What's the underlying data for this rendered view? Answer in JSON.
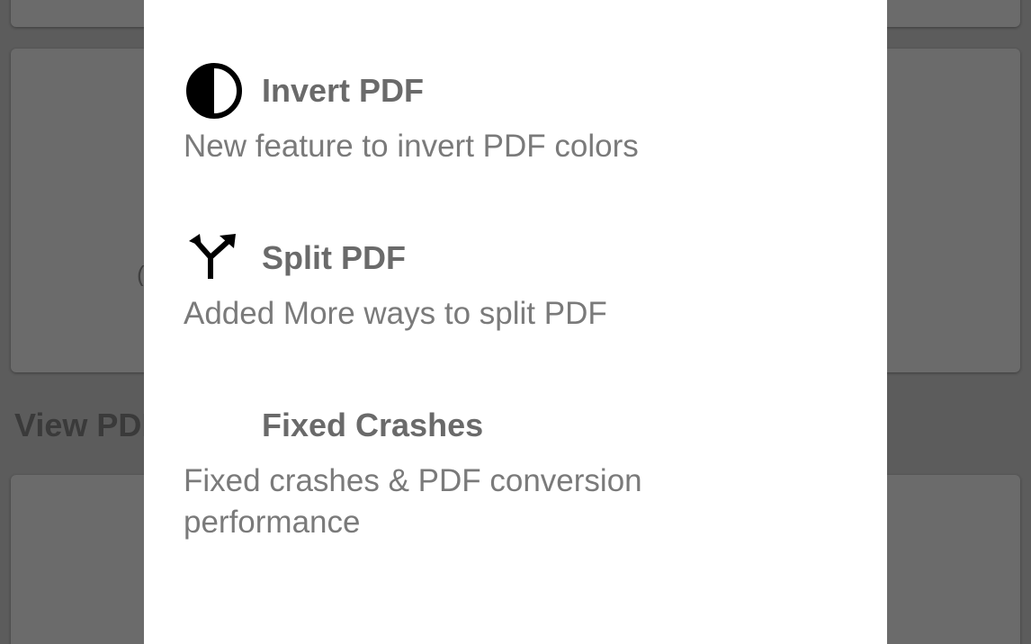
{
  "background": {
    "section_title": "View PDF",
    "card_fragment": "("
  },
  "dialog": {
    "items": [
      {
        "icon": "contrast-icon",
        "title": "Invert PDF",
        "description": "New feature to invert PDF colors"
      },
      {
        "icon": "split-arrows-icon",
        "title": "Split PDF",
        "description": "Added More ways to split PDF"
      },
      {
        "icon": "none",
        "title": "Fixed Crashes",
        "description": "Fixed crashes & PDF conversion performance"
      }
    ]
  },
  "colors": {
    "dialog_bg": "#ffffff",
    "scrim": "#5c5c5c",
    "title_text": "#6a6a6a",
    "desc_text": "#7a7a7a"
  }
}
